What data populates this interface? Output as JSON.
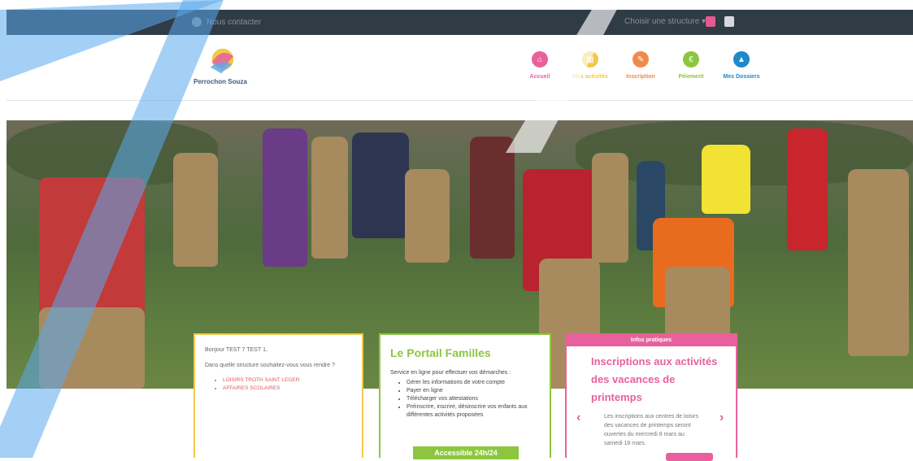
{
  "topbar": {
    "contact_label": "Nous contacter",
    "structure_label": "Choisir une structure",
    "structure_caret": "▾"
  },
  "logo": {
    "text": "Perrochon Souza"
  },
  "nav": {
    "items": [
      {
        "label": "Accueil",
        "color": "#e8619c",
        "icon": "home-icon"
      },
      {
        "label": "Mes activités",
        "color": "#f2c94c",
        "icon": "calendar-icon"
      },
      {
        "label": "Inscription",
        "color": "#f08a4b",
        "icon": "pencil-icon"
      },
      {
        "label": "Péiement",
        "color": "#8cc63f",
        "icon": "euro-icon"
      },
      {
        "label": "Mes Dossiers",
        "color": "#1f89c9",
        "icon": "folder-icon"
      }
    ]
  },
  "welcome": {
    "greeting": "Bonjour TEST 7 TEST 1,",
    "question": "Dans quelle structure souhaitez-vous vous rendre ?",
    "structures": [
      "LOISIRS TROTH SAINT LEGER",
      "AFFAIRES SCOLAIRES"
    ]
  },
  "portal": {
    "title": "Le Portail Familles",
    "intro": "Service en ligne pour effectuer vos démarches :",
    "items": [
      "Gérer les informations de votre compte",
      "Payer en ligne",
      "Télécharger vos attestations",
      "Préinscrire, inscrire, désinscrire vos enfants aux différentes activités proposées"
    ],
    "cta": "Accessible 24h/24"
  },
  "info": {
    "band": "Infos pratiques",
    "title": "Inscriptions aux activités des vacances de printemps",
    "body": "Les inscriptions aux centres de loisirs des vacances de printemps seront ouvertes du mercredi 8 mars au samedi 18 mars.",
    "prev": "‹",
    "next": "›"
  },
  "colors": {
    "topbar": "#2f3b45",
    "yellow": "#f2c94c",
    "green": "#8cc63f",
    "pink": "#e8619c",
    "blue_overlay": "#5aa9ee"
  }
}
